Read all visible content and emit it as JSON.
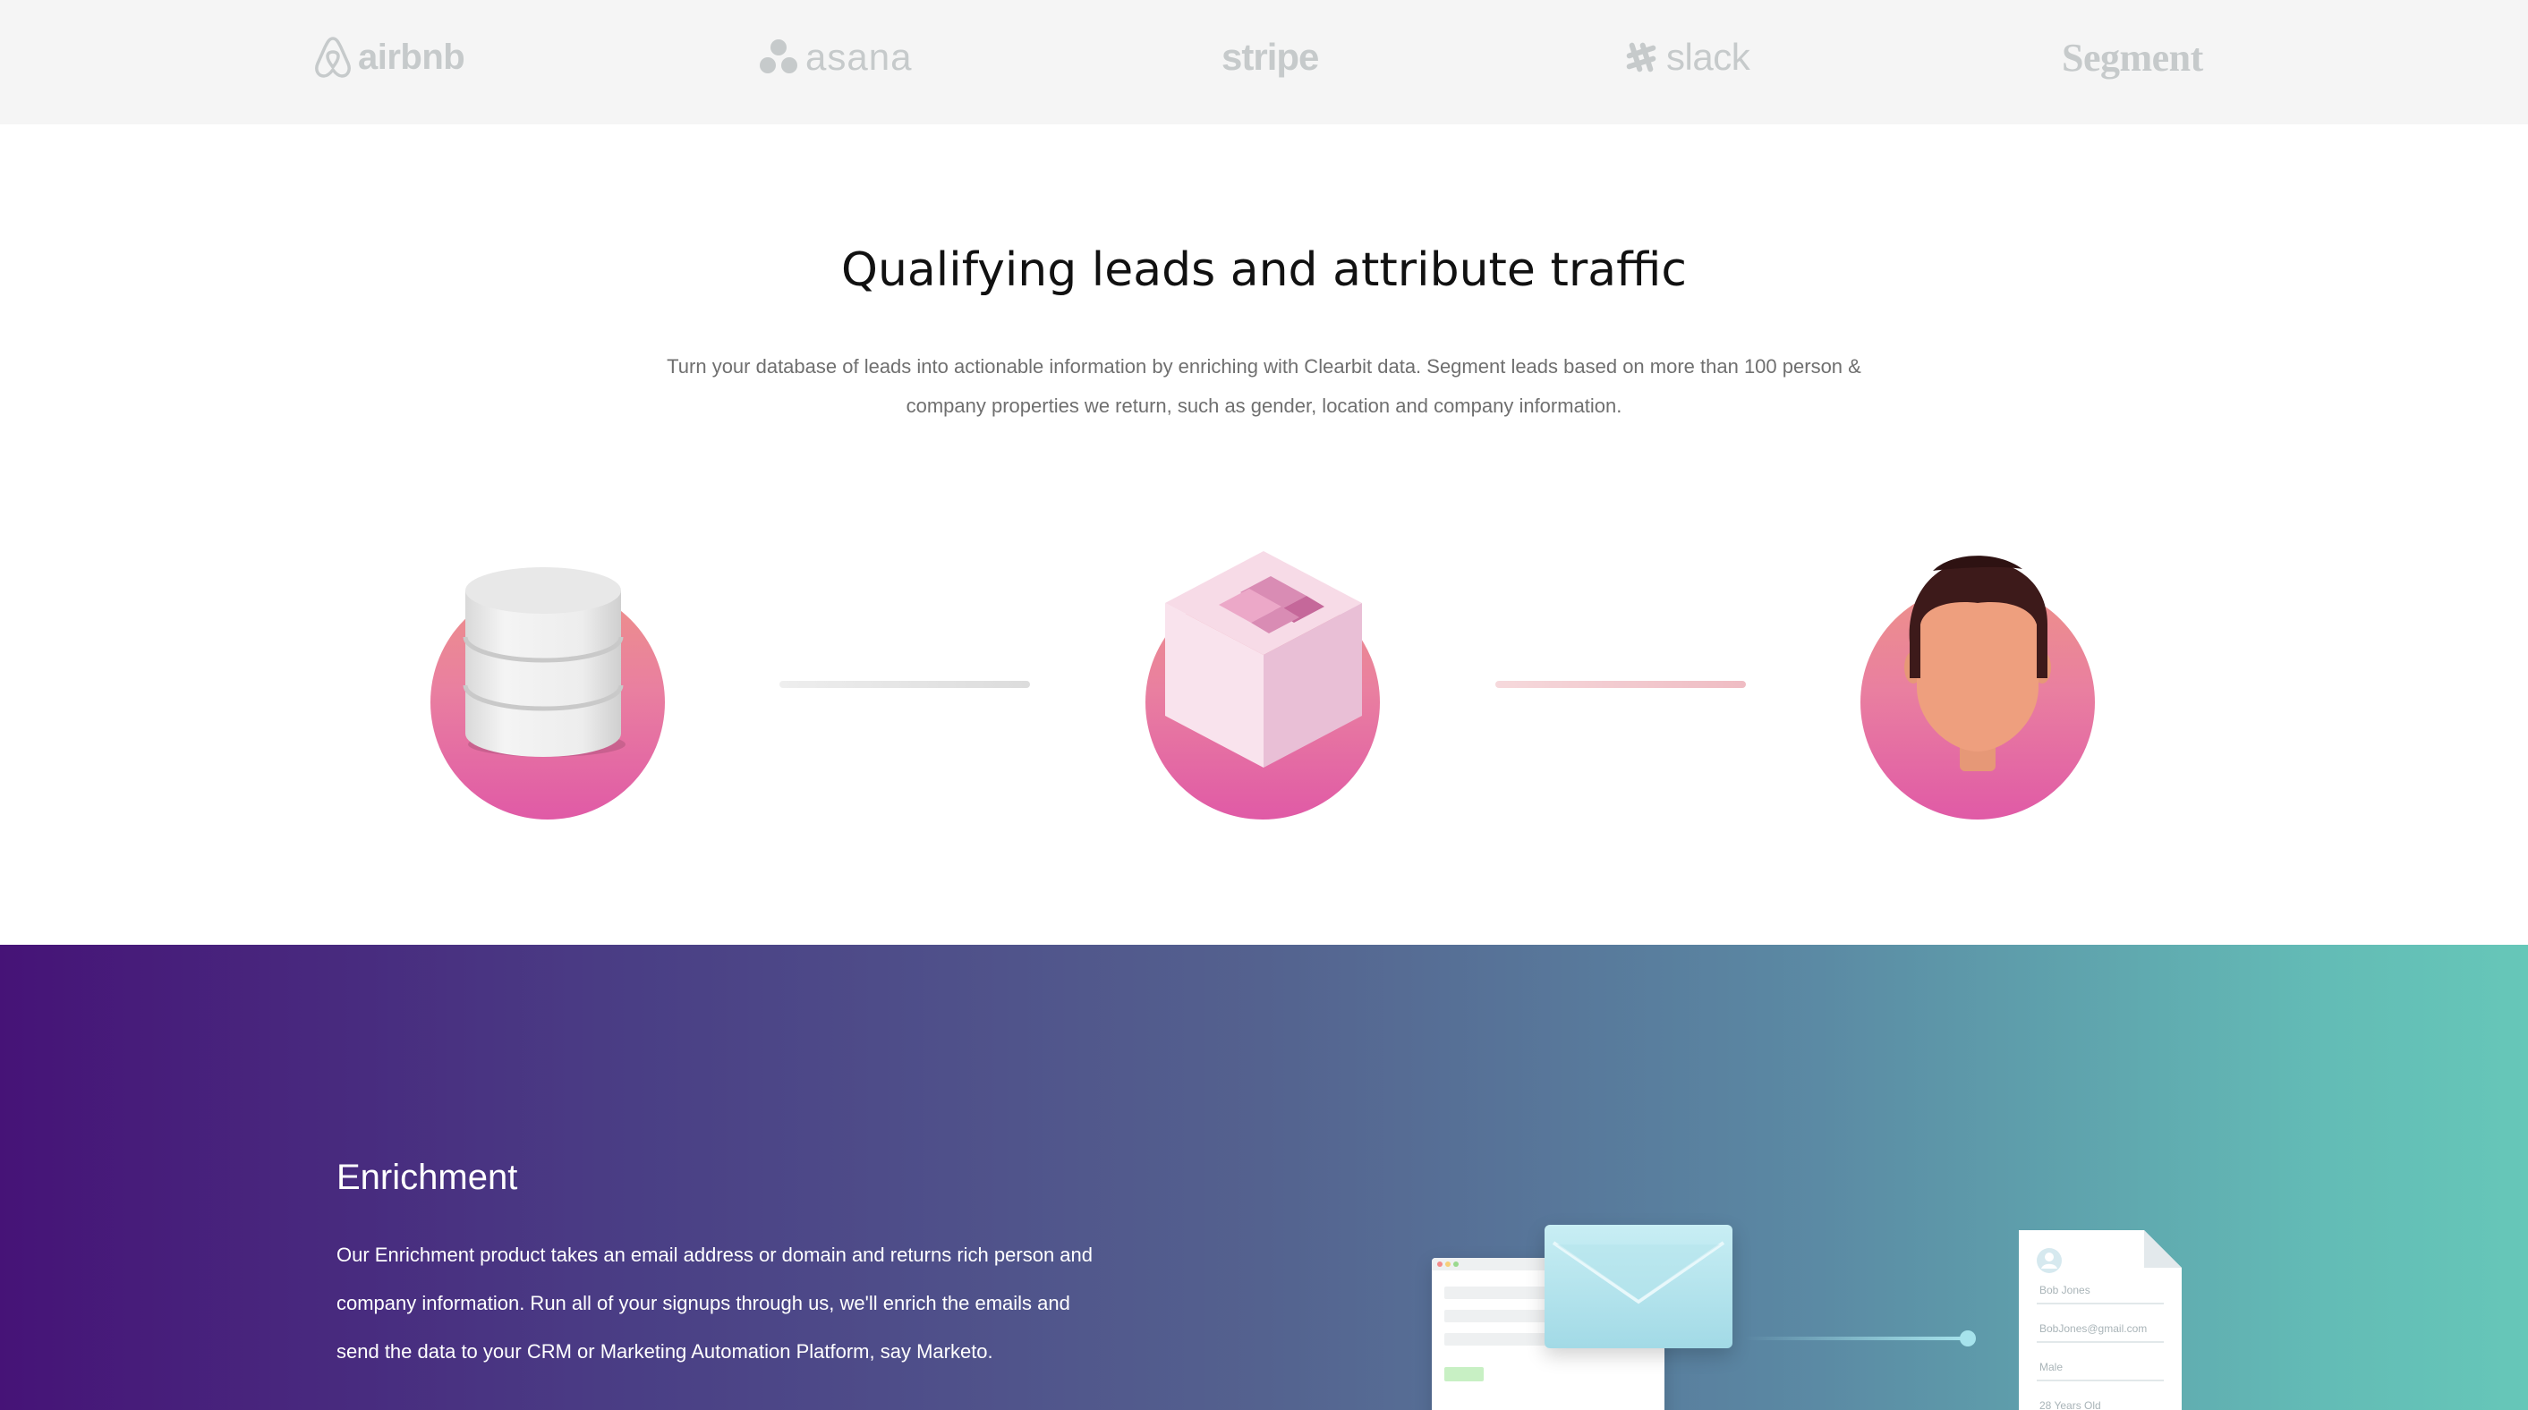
{
  "logos": {
    "airbnb": "airbnb",
    "asana": "asana",
    "stripe": "stripe",
    "slack": "slack",
    "segment": "Segment"
  },
  "qualify": {
    "title": "Qualifying leads and attribute traffic",
    "description_line1": "Turn your database of leads into actionable information by enriching with Clearbit data. Segment leads based on more than 100 person &",
    "description_line2": "company properties we return, such as gender, location and company information.",
    "steps": [
      {
        "icon": "database-icon"
      },
      {
        "icon": "clearbit-cube-icon"
      },
      {
        "icon": "person-avatar-icon"
      }
    ]
  },
  "enrichment": {
    "title": "Enrichment",
    "description_line1": "Our Enrichment product takes an email address or domain and returns rich person and",
    "description_line2": "company information. Run all of your signups through us, we'll enrich the emails and",
    "description_line3": "send the data to your CRM or Marketing Automation Platform, say Marketo.",
    "profile_card": {
      "name": "Bob Jones",
      "email": "BobJones@gmail.com",
      "gender": "Male",
      "age": "28 Years Old"
    }
  },
  "colors": {
    "logo_gray": "#c6cacb",
    "circle_top": "#ed9189",
    "circle_bottom": "#e05aa6",
    "gradient_start": "#461377",
    "gradient_end": "#66c7b8"
  }
}
